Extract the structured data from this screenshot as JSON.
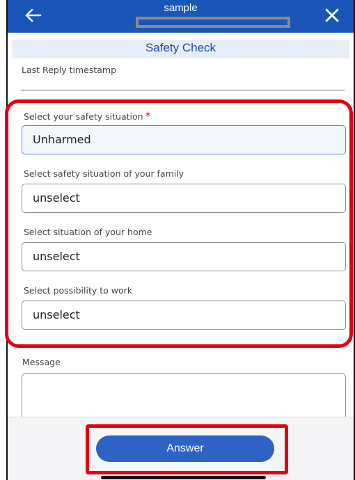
{
  "header": {
    "title": "sample",
    "back_icon": "arrow-left-icon",
    "close_icon": "close-icon",
    "background_color": "#1a56b7"
  },
  "section": {
    "title": "Safety Check"
  },
  "last_reply": {
    "label": "Last Reply timestamp",
    "value": ""
  },
  "fields": [
    {
      "label": "Select your safety situation",
      "required_marker": "*",
      "value": "Unharmed"
    },
    {
      "label": "Select safety situation of your family",
      "value": "unselect"
    },
    {
      "label": "Select situation of your home",
      "value": "unselect"
    },
    {
      "label": "Select possibility to work",
      "value": "unselect"
    }
  ],
  "message": {
    "label": "Message",
    "value": ""
  },
  "footer": {
    "answer_label": "Answer"
  },
  "colors": {
    "accent": "#2d63c5",
    "highlight": "#e3000f",
    "section_background": "#e4edf8"
  }
}
